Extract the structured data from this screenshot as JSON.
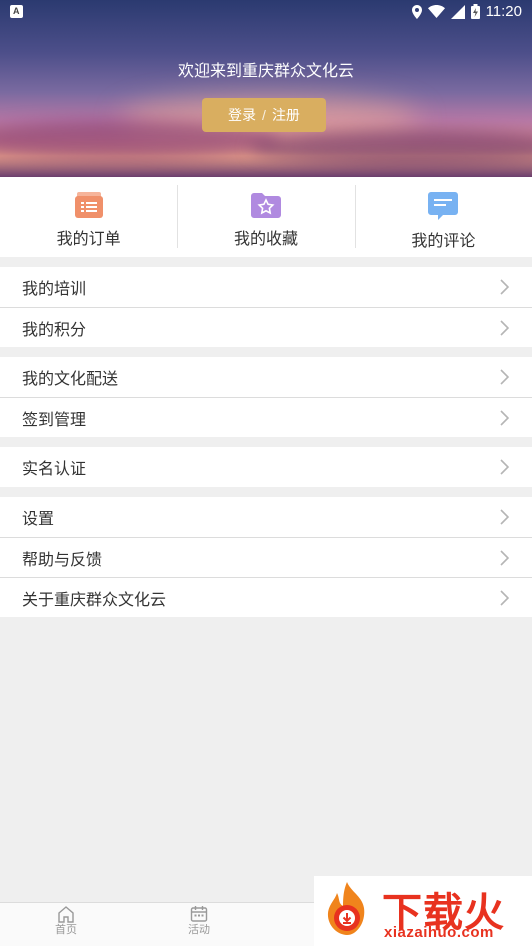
{
  "status_bar": {
    "time": "11:20"
  },
  "header": {
    "welcome_text": "欢迎来到重庆群众文化云",
    "login_label": "登录",
    "separator": "/",
    "register_label": "注册",
    "button_color": "#d9ae60"
  },
  "quick_actions": [
    {
      "label": "我的订单",
      "icon": "order-icon",
      "color": "#f0906a"
    },
    {
      "label": "我的收藏",
      "icon": "favorite-folder-icon",
      "color": "#b08ae0"
    },
    {
      "label": "我的评论",
      "icon": "comment-icon",
      "color": "#78b2f2"
    }
  ],
  "menu_groups": [
    {
      "items": [
        {
          "label": "我的培训"
        },
        {
          "label": "我的积分"
        }
      ]
    },
    {
      "items": [
        {
          "label": "我的文化配送"
        },
        {
          "label": "签到管理"
        }
      ]
    },
    {
      "items": [
        {
          "label": "实名认证"
        }
      ]
    },
    {
      "items": [
        {
          "label": "设置"
        },
        {
          "label": "帮助与反馈"
        },
        {
          "label": "关于重庆群众文化云"
        }
      ]
    }
  ],
  "tab_bar": {
    "tabs": [
      {
        "label": "首页",
        "icon": "home-icon"
      },
      {
        "label": "活动",
        "icon": "calendar-icon"
      }
    ]
  },
  "watermark": {
    "title": "下载火",
    "url": "xiazaihuo.com"
  }
}
